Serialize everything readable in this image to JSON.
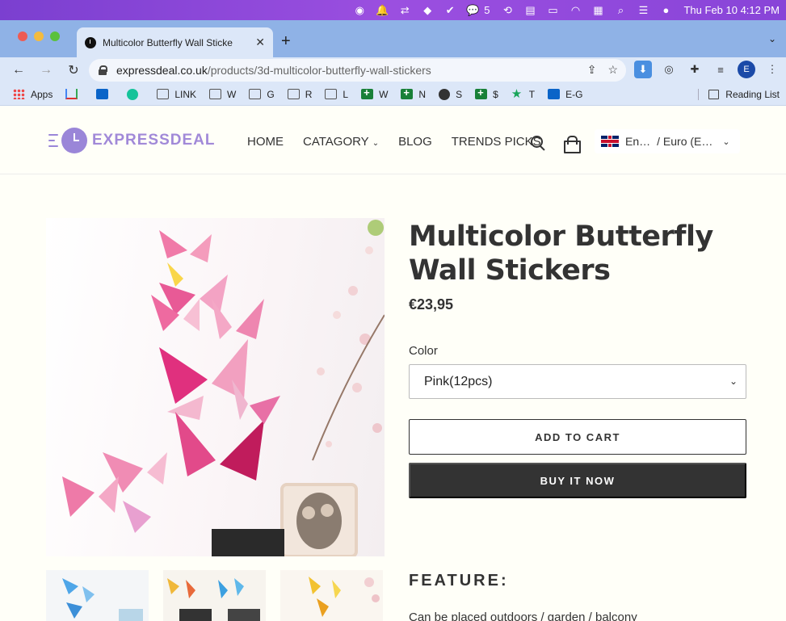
{
  "menubar": {
    "messages_count": "5",
    "clock": "Thu Feb 10  4:12 PM"
  },
  "browser": {
    "tab_title": "Multicolor Butterfly Wall Sticke",
    "url_host": "expressdeal.co.uk",
    "url_path": "/products/3d-multicolor-butterfly-wall-stickers",
    "profile_initial": "E",
    "bookmarks": [
      {
        "label": "Apps",
        "icon": "apps-icon"
      },
      {
        "label": "",
        "icon": "gmail-icon"
      },
      {
        "label": "",
        "icon": "outlook-icon"
      },
      {
        "label": "",
        "icon": "grammarly-icon"
      },
      {
        "label": "LINK",
        "icon": "folder-icon"
      },
      {
        "label": "W",
        "icon": "folder-icon"
      },
      {
        "label": "G",
        "icon": "folder-icon"
      },
      {
        "label": "R",
        "icon": "folder-icon"
      },
      {
        "label": "L",
        "icon": "folder-icon"
      },
      {
        "label": "W",
        "icon": "sheets-icon"
      },
      {
        "label": "N",
        "icon": "sheets-icon"
      },
      {
        "label": "S",
        "icon": "globe-icon"
      },
      {
        "label": "$",
        "icon": "sheets-icon"
      },
      {
        "label": "T",
        "icon": "star-icon"
      },
      {
        "label": "E-G",
        "icon": "outlook-icon"
      }
    ],
    "reading_list": "Reading List"
  },
  "site": {
    "logo": "EXPRESSDEAL",
    "nav": {
      "home": "HOME",
      "category": "CATAGORY",
      "blog": "BLOG",
      "trends": "TRENDS PICKS"
    },
    "locale_lang": "En…",
    "locale_currency": "/ Euro (E…"
  },
  "product": {
    "title": "Multicolor Butterfly Wall Stickers",
    "price": "€23,95",
    "color_label": "Color",
    "color_value": "Pink(12pcs)",
    "add_to_cart": "ADD TO CART",
    "buy_now": "BUY IT NOW",
    "feature_heading": "FEATURE:",
    "feature_line": "Can be placed outdoors / garden / balcony"
  },
  "colors": {
    "accent_logo": "#a189d8",
    "button_dark": "#333333",
    "tab_bar": "#8fb2e6"
  }
}
